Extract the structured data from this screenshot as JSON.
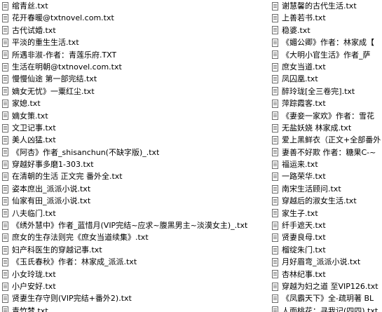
{
  "files_left": [
    "绾青丝.txt",
    "花开春暖@txtnovel.com.txt",
    "古代试婚.txt",
    "平淡的重生生活.txt",
    "所遇非淑-作者：青莲乐府.TXT",
    "生活在明朝@txtnovel.com.txt",
    "慢慢仙途 第一部完结.txt",
    "嫡女无忧》一粟红尘.txt",
    "家媳.txt",
    "嫡女策.txt",
    "文卫记事.txt",
    "美人凶猛.txt",
    "《阿杏》作者_shisanchun(不缺字版)_.txt",
    "穿越好事多磨1-303.txt",
    "在清朝的生活   正文完 番外全.txt",
    "姿本庶出_派派小说.txt",
    "仙家有田_派派小说.txt",
    "八夫临门.txt",
    "《绣外慧中》作者_蓝惜月(VIP完结~应求~腹黑男主~淡漠女主)_.txt",
    "庶女的生存法则完《庶女当道续集》.txt",
    "妇产科医生的穿越记事.txt",
    "《玉氏春秋》作者：林家成_派派.txt",
    "小女玲珑.txt",
    "小户安好.txt",
    "贤妻生存守则(VIP完结+番外2).txt",
    "青竹梦.txt"
  ],
  "files_right": [
    "谢慧馨的古代生活.txt",
    "上善若书.txt",
    "稳婆.txt",
    "《媚公卿》作者：林家成【",
    "《大明小官生活》作者_萨",
    "庶女当道.txt",
    "凤囚凰.txt",
    "醉玲珑[全三卷完].txt",
    "萍踪霞客.txt",
    "《妻妾一家欢》作者：雪花",
    "无盐妖娆 林家成.txt",
    "爱上黑鲜衣（正文+全部番外",
    "妻善不好欺 作者：糖果C-~",
    "福运来.txt",
    "一路荣华.txt",
    "南宋生活顾问.txt",
    "穿越后的淑女生活.txt",
    "家生子.txt",
    "纤手遮天.txt",
    "贤妻良母.txt",
    "榴绽朱门.txt",
    "月好眉弯_派派小说.txt",
    "杏林纪事.txt",
    "穿越为妇之道 至VIP126.txt",
    "《凤霸天下》全-疏玥著 BL",
    "人面桃花：寻我记(四四).txt"
  ]
}
